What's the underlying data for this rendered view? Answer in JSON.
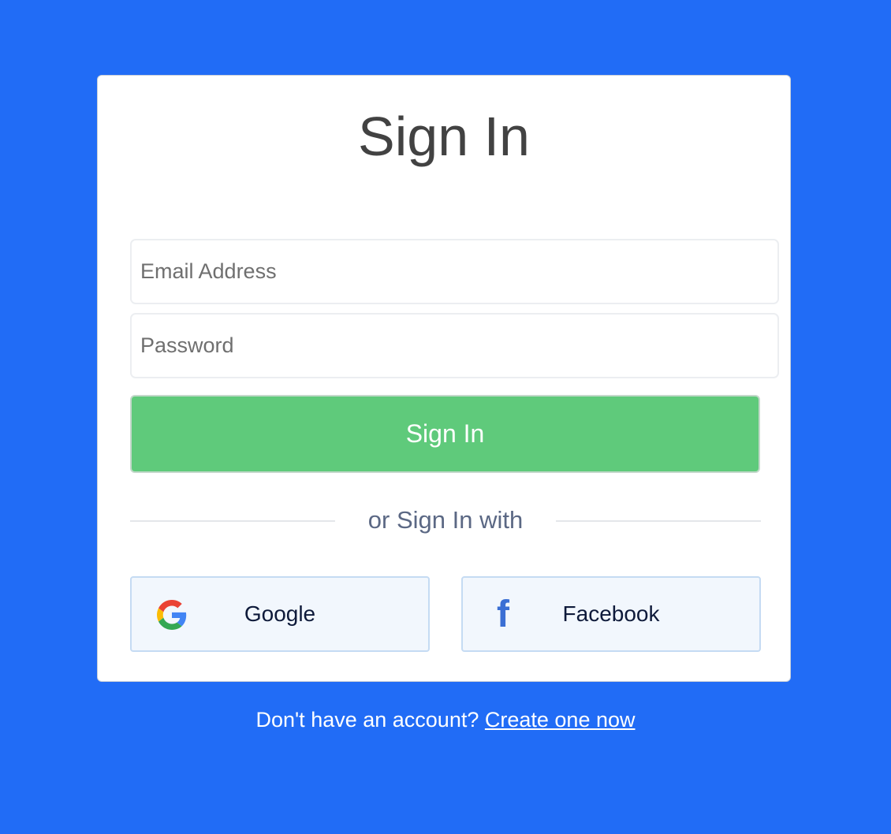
{
  "page": {
    "background_color": "#216cf6"
  },
  "card": {
    "title": "Sign In",
    "email": {
      "placeholder": "Email Address",
      "value": ""
    },
    "password": {
      "placeholder": "Password",
      "value": ""
    },
    "submit_label": "Sign In",
    "submit_color": "#5fca7b",
    "divider_text": "or Sign In with",
    "social": {
      "google": {
        "label": "Google",
        "icon": "google-icon"
      },
      "facebook": {
        "label": "Facebook",
        "icon": "facebook-icon"
      }
    }
  },
  "footer": {
    "prompt": "Don't have an account?",
    "link_label": "Create one now"
  }
}
